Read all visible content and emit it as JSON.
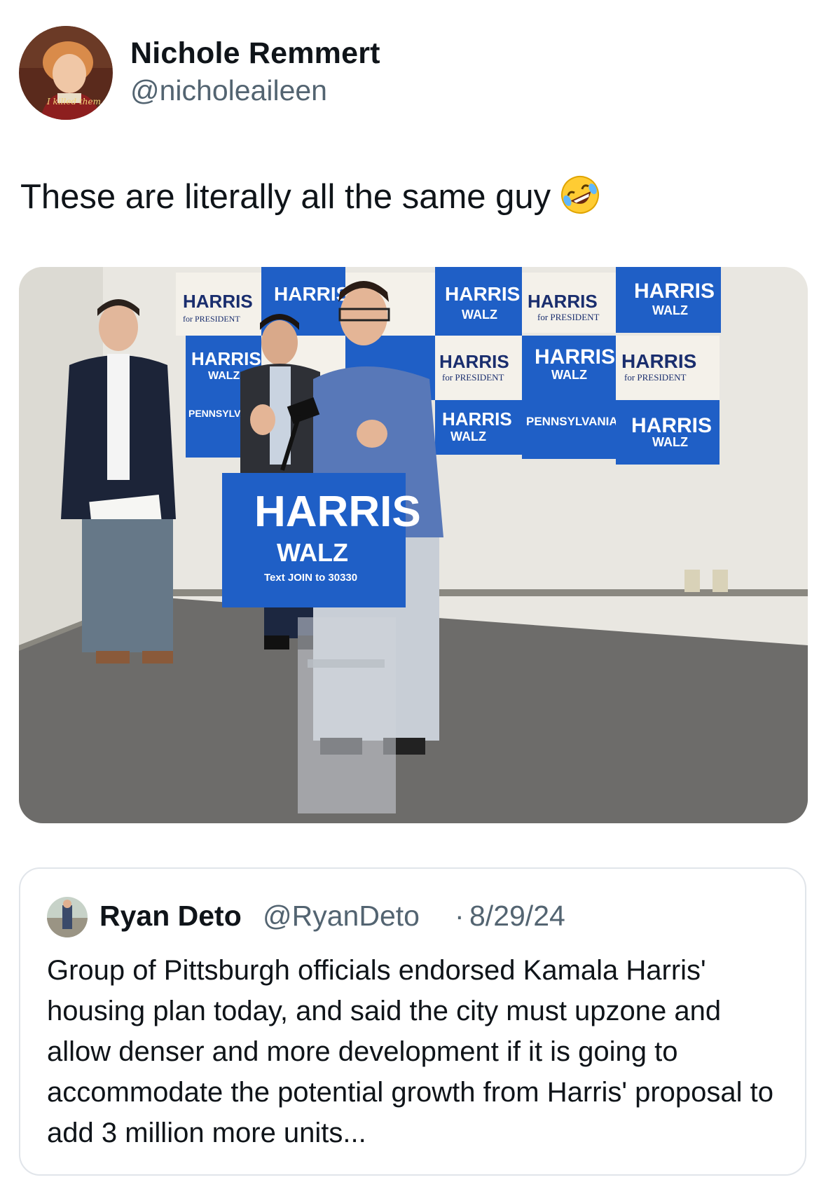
{
  "author": {
    "name": "Nichole Remmert",
    "handle": "@nicholeaileen",
    "avatar_caption": "I killed them all."
  },
  "tweet": {
    "text": "These are literally all the same guy",
    "emoji": "rolling-on-floor-laughing"
  },
  "photo": {
    "podium_sign": {
      "line1": "HARRIS",
      "line2": "WALZ",
      "line3": "Text JOIN to 30330"
    },
    "wall_signs": [
      {
        "title": "HARRIS",
        "sub": "for PRESIDENT"
      },
      {
        "title": "HARRIS",
        "sub": "WALZ"
      },
      {
        "title": "PENNSYLVANIA",
        "sub": "HARRIS WALZ"
      }
    ]
  },
  "quote": {
    "name": "Ryan Deto",
    "handle": "@RyanDeto",
    "separator": "·",
    "date": "8/29/24",
    "text": "Group of Pittsburgh officials endorsed Kamala Harris' housing plan today, and said the city must upzone and allow denser and more development if it is going to accommodate the potential growth from Harris' proposal to add 3 million more units..."
  },
  "colors": {
    "handle_gray": "#536471",
    "sign_blue": "#1f5fc6",
    "sign_navy": "#1a2e6e"
  }
}
